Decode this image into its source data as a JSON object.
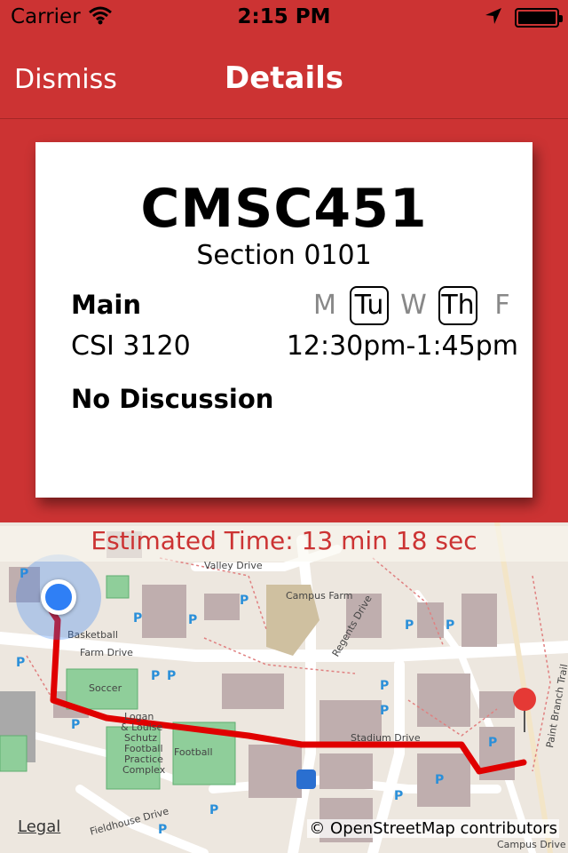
{
  "status_bar": {
    "carrier": "Carrier",
    "time": "2:15 PM",
    "wifi_icon": "wifi-icon",
    "location_icon": "location-arrow-icon",
    "battery_icon": "battery-full-icon"
  },
  "nav": {
    "dismiss_label": "Dismiss",
    "title": "Details"
  },
  "course": {
    "code": "CMSC451",
    "section": "Section 0101",
    "meeting_type": "Main",
    "room": "CSI 3120",
    "time_range": "12:30pm-1:45pm",
    "discussion": "No Discussion",
    "days": [
      {
        "label": "M",
        "active": false
      },
      {
        "label": "Tu",
        "active": true
      },
      {
        "label": "W",
        "active": false
      },
      {
        "label": "Th",
        "active": true
      },
      {
        "label": "F",
        "active": false
      }
    ]
  },
  "map": {
    "eta": "Estimated Time: 13 min 18 sec",
    "legal": "Legal",
    "attribution": "© OpenStreetMap contributors",
    "labels": {
      "valley_drive": "Valley Drive",
      "campus_farm": "Campus Farm",
      "regents_drive": "Regents Drive",
      "basketball": "Basketball",
      "farm_drive": "Farm Drive",
      "soccer": "Soccer",
      "logan": "Logan",
      "louise": "& Louise",
      "schutz": "Schutz",
      "football_practice": "Football",
      "practice": "Practice",
      "complex": "Complex",
      "football": "Football",
      "fieldhouse_drive": "Fieldhouse Drive",
      "stadium_drive": "Stadium Drive",
      "paint_branch_trail": "Paint Branch Trail",
      "campus_drive": "Campus Drive"
    },
    "parking_symbol": "P",
    "colors": {
      "route": "#e00000",
      "user_location": "#2f7ff5",
      "destination_pin": "#e53935",
      "building": "#bfaeae",
      "field": "#8fce9a"
    }
  }
}
